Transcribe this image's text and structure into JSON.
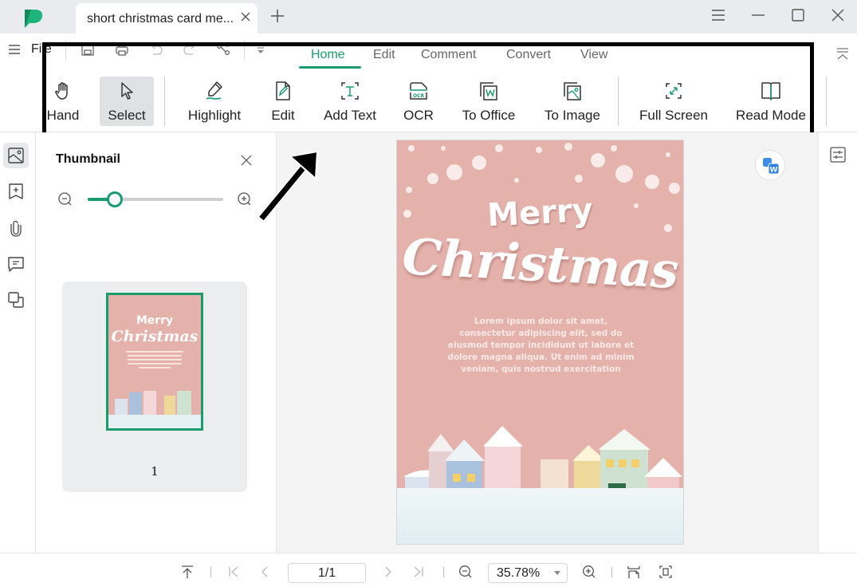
{
  "app": {
    "tab_title": "short christmas card me...",
    "brand_color": "#1a9b6c"
  },
  "quickbar": {
    "file_label": "File",
    "icons": [
      "save-icon",
      "print-icon",
      "undo-icon",
      "redo-icon",
      "share-icon",
      "customize-icon"
    ]
  },
  "ribbon": {
    "tabs": [
      {
        "label": "Home",
        "active": true
      },
      {
        "label": "Edit",
        "active": false
      },
      {
        "label": "Comment",
        "active": false
      },
      {
        "label": "Convert",
        "active": false
      },
      {
        "label": "View",
        "active": false
      }
    ],
    "tools": [
      {
        "label": "Hand",
        "icon": "hand-icon"
      },
      {
        "label": "Select",
        "icon": "cursor-icon",
        "selected": true
      },
      {
        "label": "Highlight",
        "icon": "highlighter-icon"
      },
      {
        "label": "Edit",
        "icon": "edit-doc-icon"
      },
      {
        "label": "Add Text",
        "icon": "add-text-icon"
      },
      {
        "label": "OCR",
        "icon": "ocr-icon"
      },
      {
        "label": "To Office",
        "icon": "to-office-icon"
      },
      {
        "label": "To Image",
        "icon": "to-image-icon"
      },
      {
        "label": "Full Screen",
        "icon": "full-screen-icon"
      },
      {
        "label": "Read Mode",
        "icon": "book-icon"
      }
    ]
  },
  "left_rail": [
    "thumbnail-icon",
    "bookmark-icon",
    "attachment-icon",
    "comment-icon",
    "layers-icon"
  ],
  "thumbnail_panel": {
    "title": "Thumbnail",
    "zoom_slider_fraction": 0.2,
    "pages": [
      {
        "number": "1",
        "selected": true
      }
    ]
  },
  "document": {
    "heading_line1": "Merry",
    "heading_line2": "Christmas",
    "body": "Lorem ipsum dolor sit amet, consectetur adipiscing elit, sed do eiusmod tempor incididunt ut labore et dolore magna aliqua. Ut enim ad minim veniam, quis nostrud exercitation",
    "background_color": "#e5b2ab"
  },
  "statusbar": {
    "page_indicator": "1/1",
    "zoom_level": "35.78%"
  }
}
